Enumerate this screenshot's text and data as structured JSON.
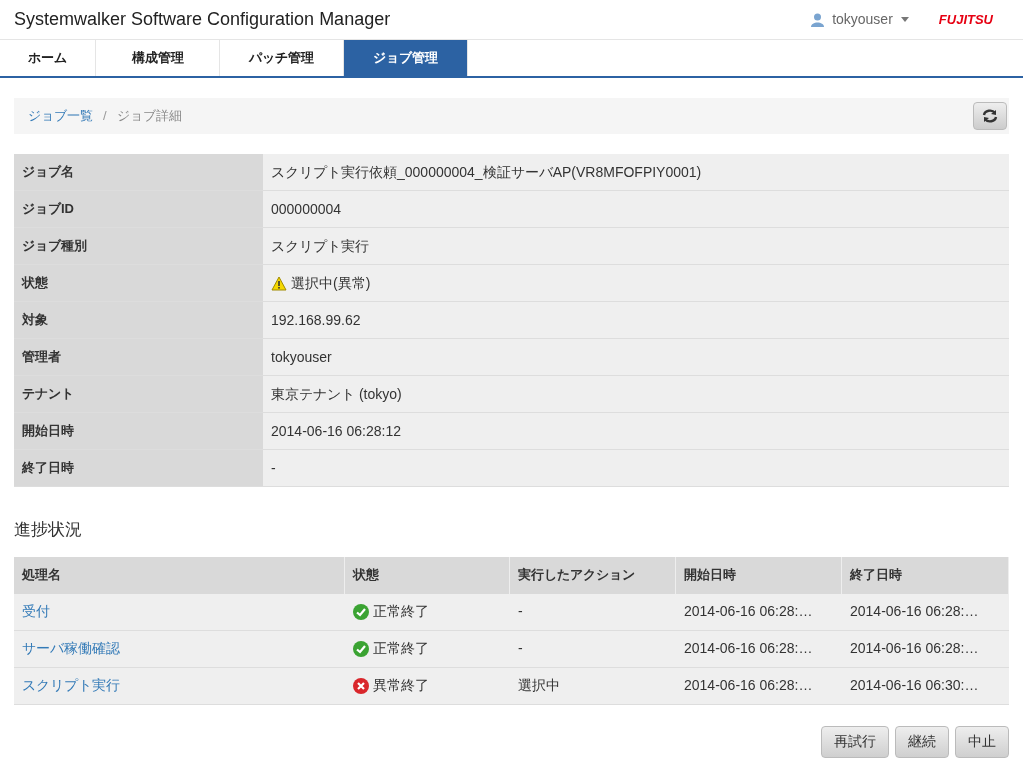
{
  "header": {
    "title": "Systemwalker Software Configuration Manager",
    "user": "tokyouser",
    "logo": "FUJITSU"
  },
  "tabs": [
    {
      "label": "ホーム",
      "selected": false
    },
    {
      "label": "構成管理",
      "selected": false
    },
    {
      "label": "パッチ管理",
      "selected": false
    },
    {
      "label": "ジョブ管理",
      "selected": true
    }
  ],
  "breadcrumb": [
    {
      "label": "ジョブ一覧",
      "kind": "link"
    },
    {
      "label": "/",
      "kind": "separator"
    },
    {
      "label": "ジョブ詳細",
      "kind": "current"
    }
  ],
  "details": [
    {
      "label": "ジョブ名",
      "value": "スクリプト実行依頼_000000004_検証サーバAP(VR8MFOFPIY0001)"
    },
    {
      "label": "ジョブID",
      "value": "000000004"
    },
    {
      "label": "ジョブ種別",
      "value": "スクリプト実行"
    },
    {
      "label": "状態",
      "value": "選択中(異常)",
      "kind": "warning"
    },
    {
      "label": "対象",
      "value": "192.168.99.62"
    },
    {
      "label": "管理者",
      "value": "tokyouser"
    },
    {
      "label": "テナント",
      "value": "東京テナント (tokyo)"
    },
    {
      "label": "開始日時",
      "value": "2014-06-16 06:28:12"
    },
    {
      "label": "終了日時",
      "value": "-"
    }
  ],
  "progress": {
    "title": "進捗状況",
    "columns": [
      "処理名",
      "状態",
      "実行したアクション",
      "開始日時",
      "終了日時"
    ],
    "rows": [
      {
        "name": "受付",
        "status": "正常終了",
        "kind": "success",
        "action": "-",
        "start": "2014-06-16 06:28:…",
        "end": "2014-06-16 06:28:…"
      },
      {
        "name": "サーバ稼働確認",
        "status": "正常終了",
        "kind": "success",
        "action": "-",
        "start": "2014-06-16 06:28:…",
        "end": "2014-06-16 06:28:…"
      },
      {
        "name": "スクリプト実行",
        "status": "異常終了",
        "kind": "error",
        "action": "選択中",
        "start": "2014-06-16 06:28:…",
        "end": "2014-06-16 06:30:…"
      }
    ]
  },
  "buttons": [
    "再試行",
    "継続",
    "中止"
  ]
}
